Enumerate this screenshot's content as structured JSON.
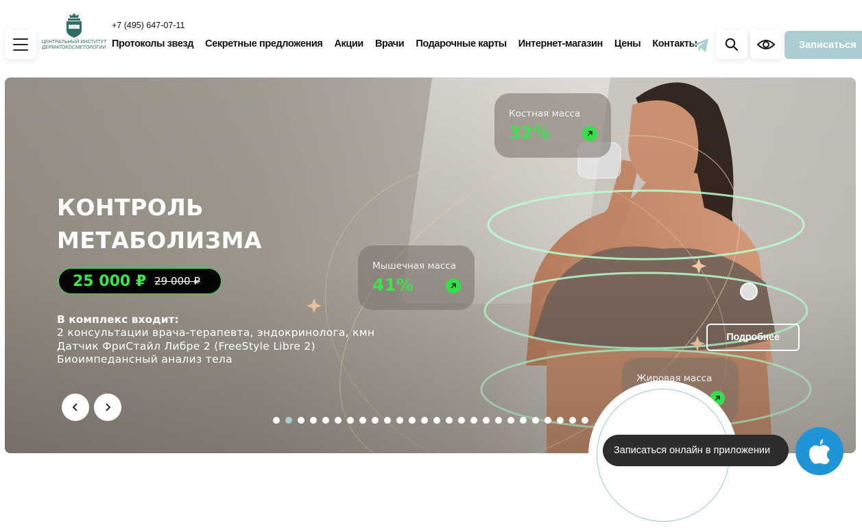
{
  "header": {
    "phone": "+7 (495) 647-07-11",
    "logo_line1": "ЦЕНТРАЛЬНЫЙ ИНСТИТУТ",
    "logo_line2": "ДЕРМАТОКОСМЕТОЛОГИИ",
    "logo_badge": "ЦИДК",
    "nav": [
      {
        "label": "Протоколы звезд"
      },
      {
        "label": "Секретные предложения"
      },
      {
        "label": "Акции"
      },
      {
        "label": "Врачи"
      },
      {
        "label": "Подарочные карты"
      },
      {
        "label": "Интернет-магазин"
      },
      {
        "label": "Цены"
      },
      {
        "label": "Контакты"
      }
    ],
    "signup_label": "Записаться"
  },
  "hero": {
    "title_line1": "КОНТРОЛЬ",
    "title_line2": "МЕТАБОЛИЗМА",
    "price_new": "25 000 ₽",
    "price_old": "29 000 ₽",
    "includes_heading": "В комплекс входит:",
    "includes": [
      "2 консультации врача-терапевта, эндокринолога, кмн",
      "Датчик ФриСтайл Либре 2 (FreeStyle Libre 2)",
      "Биоимпедансный анализ тела"
    ],
    "stats": [
      {
        "label": "Костная масса",
        "value": "32%"
      },
      {
        "label": "Мышечная масса",
        "value": "41%"
      },
      {
        "label": "Жировая масса",
        "value": ""
      }
    ],
    "more_label": "Подробнее",
    "slides_total": 26,
    "slide_active": 2
  },
  "app_promo": {
    "label": "Записаться онлайн в приложении"
  },
  "colors": {
    "accent_green": "#3ee24e",
    "signup_bg": "#a9cdd0",
    "apple_blue": "#1f95d8"
  }
}
